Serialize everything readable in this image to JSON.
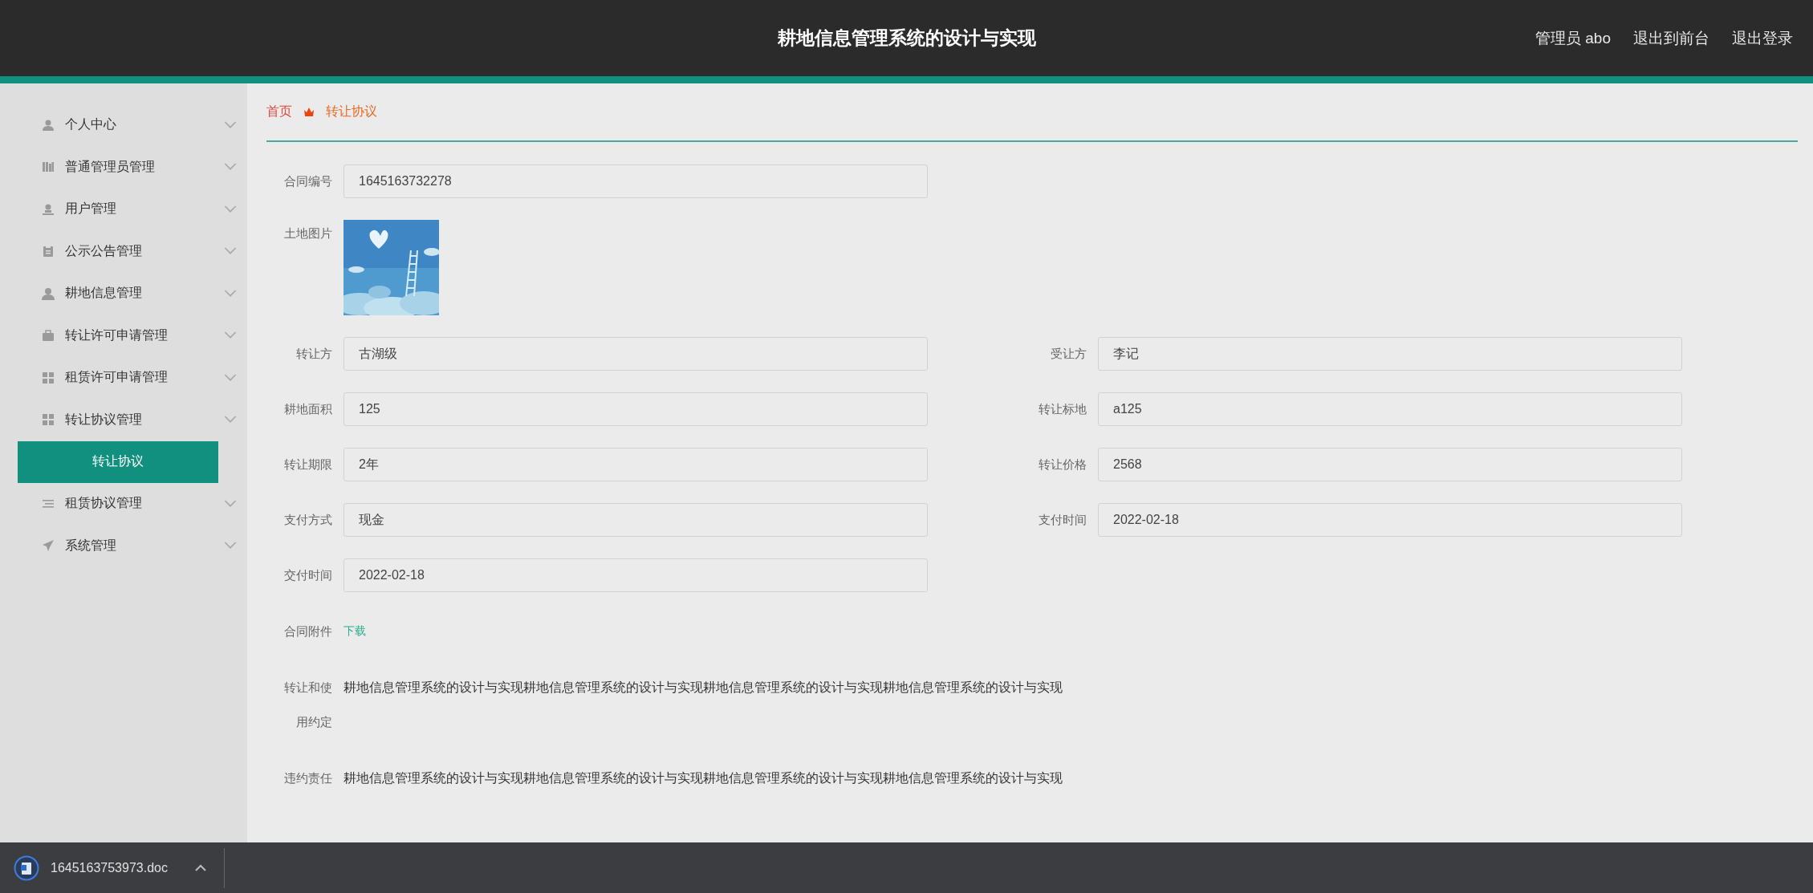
{
  "header": {
    "title": "耕地信息管理系统的设计与实现",
    "user": "管理员 abo",
    "links": [
      "退出到前台",
      "退出登录"
    ]
  },
  "sidebar": {
    "items": [
      {
        "label": "个人中心"
      },
      {
        "label": "普通管理员管理"
      },
      {
        "label": "用户管理"
      },
      {
        "label": "公示公告管理"
      },
      {
        "label": "耕地信息管理"
      },
      {
        "label": "转让许可申请管理"
      },
      {
        "label": "租赁许可申请管理"
      },
      {
        "label": "转让协议管理",
        "children": [
          {
            "label": "转让协议",
            "selected": true
          }
        ]
      },
      {
        "label": "租赁协议管理"
      },
      {
        "label": "系统管理"
      }
    ]
  },
  "breadcrumb": [
    "首页",
    "转让协议"
  ],
  "form": {
    "rows": [
      [
        {
          "kind": "input",
          "label": "合同编号",
          "value": "1645163732278"
        }
      ],
      [
        {
          "kind": "picture",
          "label": "土地图片"
        }
      ],
      [
        {
          "kind": "input",
          "label": "转让方",
          "value": "古湖级"
        },
        {
          "kind": "input",
          "label": "受让方",
          "value": "李记"
        }
      ],
      [
        {
          "kind": "input",
          "label": "耕地面积",
          "value": "125"
        },
        {
          "kind": "input",
          "label": "转让标地",
          "value": "a125"
        }
      ],
      [
        {
          "kind": "input",
          "label": "转让期限",
          "value": "2年"
        },
        {
          "kind": "input",
          "label": "转让价格",
          "value": "2568"
        }
      ],
      [
        {
          "kind": "input",
          "label": "支付方式",
          "value": "现金"
        },
        {
          "kind": "input",
          "label": "支付时间",
          "value": "2022-02-18"
        }
      ],
      [
        {
          "kind": "input",
          "label": "交付时间",
          "value": "2022-02-18"
        }
      ],
      [
        {
          "kind": "link",
          "label": "合同附件",
          "value": "下载"
        }
      ],
      [
        {
          "kind": "text",
          "label": "转让和使用约定",
          "value": "耕地信息管理系统的设计与实现耕地信息管理系统的设计与实现耕地信息管理系统的设计与实现耕地信息管理系统的设计与实现"
        }
      ],
      [
        {
          "kind": "text",
          "label": "违约责任",
          "value": "耕地信息管理系统的设计与实现耕地信息管理系统的设计与实现耕地信息管理系统的设计与实现耕地信息管理系统的设计与实现"
        }
      ]
    ]
  },
  "download_bar": {
    "file": "1645163753973.doc"
  }
}
